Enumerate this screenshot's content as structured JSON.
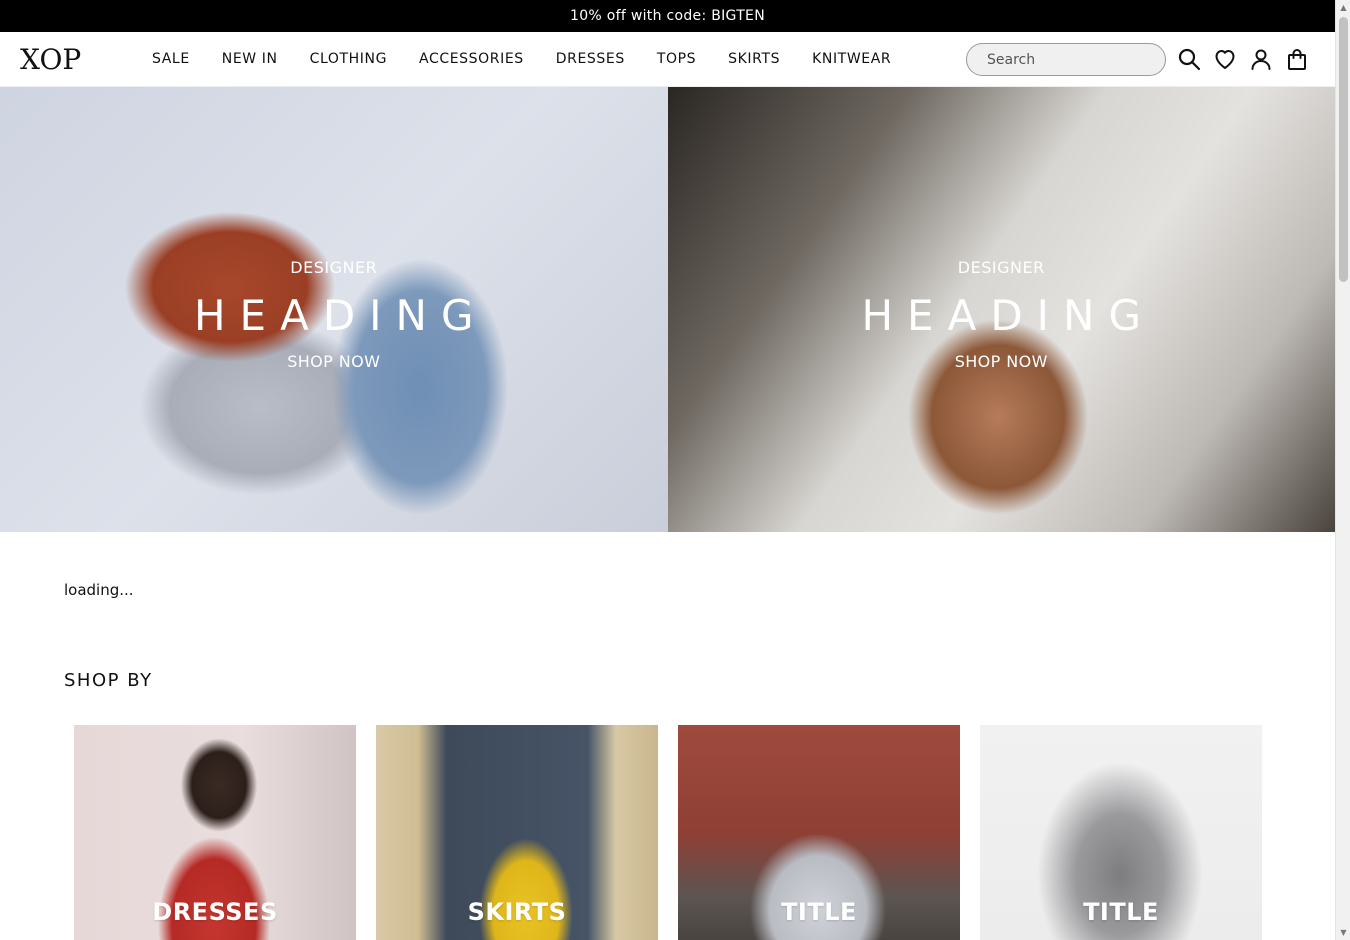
{
  "promo": {
    "text": "10% off with code: BIGTEN"
  },
  "header": {
    "logo": "XOP",
    "nav": [
      "SALE",
      "NEW IN",
      "CLOTHING",
      "ACCESSORIES",
      "DRESSES",
      "TOPS",
      "SKIRTS",
      "KNITWEAR"
    ],
    "search_placeholder": "Search",
    "icons": [
      "search-icon",
      "heart-icon",
      "user-icon",
      "bag-icon"
    ]
  },
  "hero": [
    {
      "subtitle": "DESIGNER",
      "title": "HEADING",
      "cta": "SHOP NOW"
    },
    {
      "subtitle": "DESIGNER",
      "title": "HEADING",
      "cta": "SHOP NOW"
    }
  ],
  "loading_text": "loading...",
  "shop_by": {
    "heading": "SHOP BY",
    "cards": [
      {
        "label": "DRESSES"
      },
      {
        "label": "SKIRTS"
      },
      {
        "label": "TITLE"
      },
      {
        "label": "TITLE"
      }
    ]
  },
  "colors": {
    "promo_bg": "#000000",
    "text": "#111111",
    "search_bg": "#f0f0f0"
  }
}
